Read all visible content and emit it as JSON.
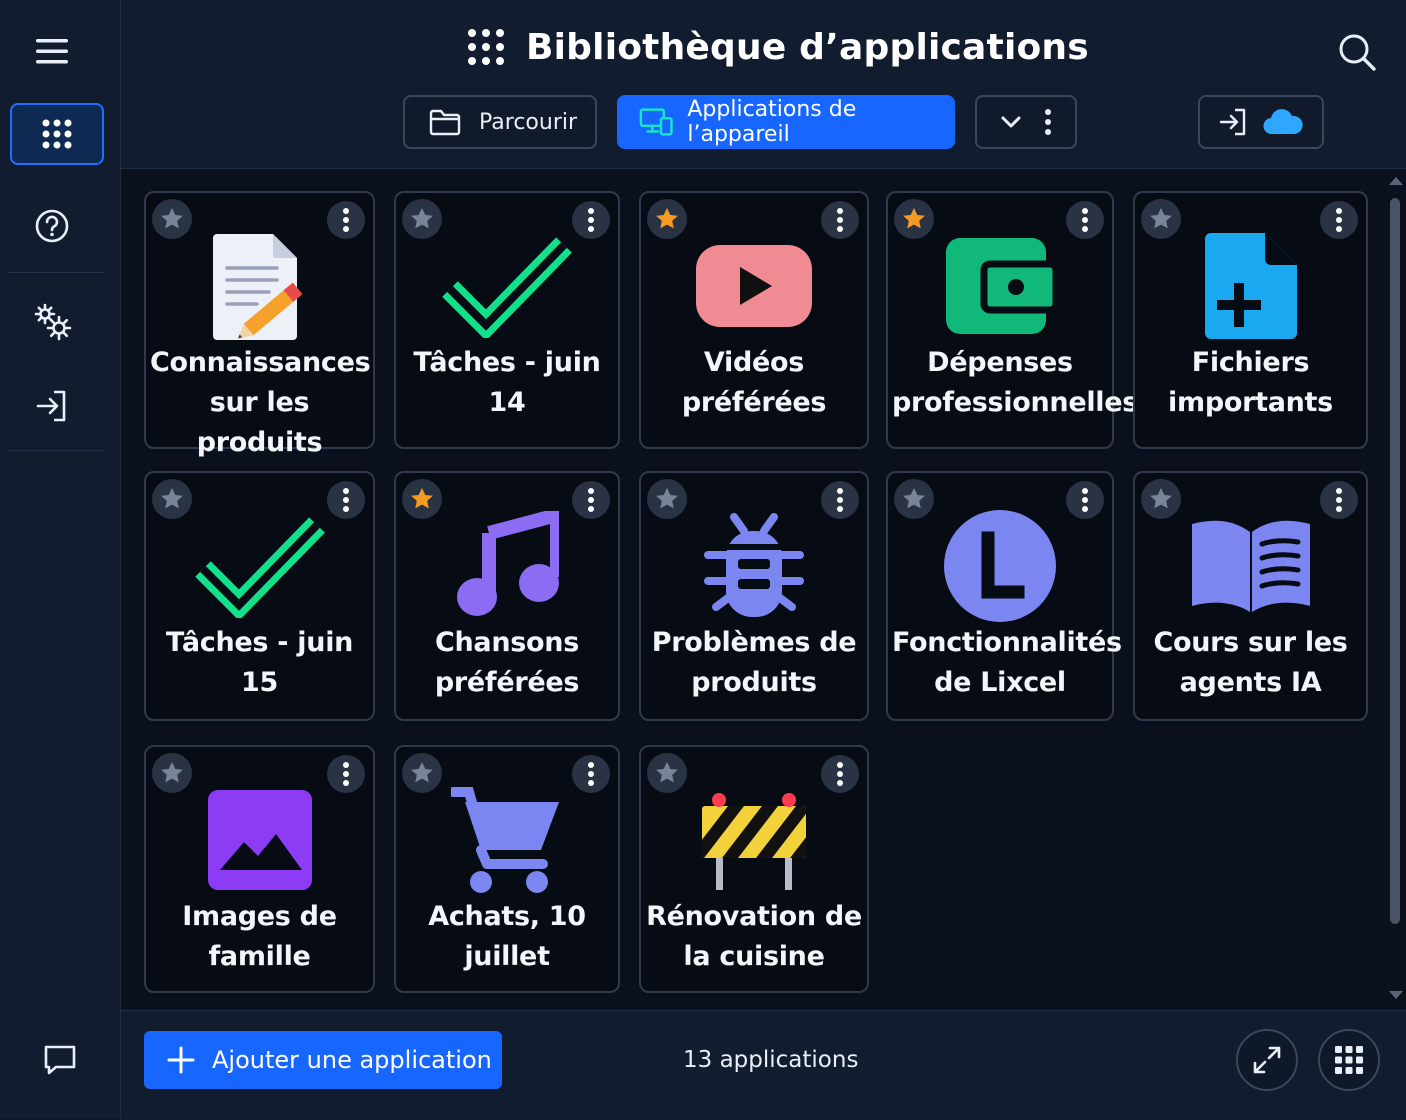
{
  "header": {
    "title": "Bibliothèque d’applications",
    "browse_label": "Parcourir",
    "device_apps_label": "Applications de l’appareil"
  },
  "apps": [
    {
      "label": "Connaissances sur les produits",
      "starred": false,
      "icon": "document-pencil-icon"
    },
    {
      "label": "Tâches - juin 14",
      "starred": false,
      "icon": "checkmark-icon"
    },
    {
      "label": "Vidéos préférées",
      "starred": true,
      "icon": "video-play-icon"
    },
    {
      "label": "Dépenses professionnelles",
      "starred": true,
      "icon": "wallet-icon"
    },
    {
      "label": "Fichiers importants",
      "starred": false,
      "icon": "file-add-icon"
    },
    {
      "label": "Tâches - juin 15",
      "starred": false,
      "icon": "checkmark-icon"
    },
    {
      "label": "Chansons préférées",
      "starred": true,
      "icon": "music-note-icon"
    },
    {
      "label": "Problèmes de produits",
      "starred": false,
      "icon": "bug-icon"
    },
    {
      "label": "Fonctionnalités de Lixcel",
      "starred": false,
      "icon": "letter-l-icon"
    },
    {
      "label": "Cours sur les agents IA",
      "starred": false,
      "icon": "open-book-icon"
    },
    {
      "label": "Images de famille",
      "starred": false,
      "icon": "image-icon"
    },
    {
      "label": "Achats, 10 juillet",
      "starred": false,
      "icon": "shopping-cart-icon"
    },
    {
      "label": "Rénovation de la cuisine",
      "starred": false,
      "icon": "construction-barrier-icon"
    }
  ],
  "footer": {
    "add_label": "Ajouter une application",
    "count_label": "13 applications"
  },
  "colors": {
    "accent": "#1766ff",
    "star_active": "#f59a23",
    "star_inactive": "#7a8496",
    "check_green": "#12e08a",
    "wallet_green": "#10b97a",
    "file_blue": "#1aa8f0",
    "periwinkle": "#7b86f0",
    "purple": "#8c3cf5",
    "video_pink": "#f08a93"
  }
}
